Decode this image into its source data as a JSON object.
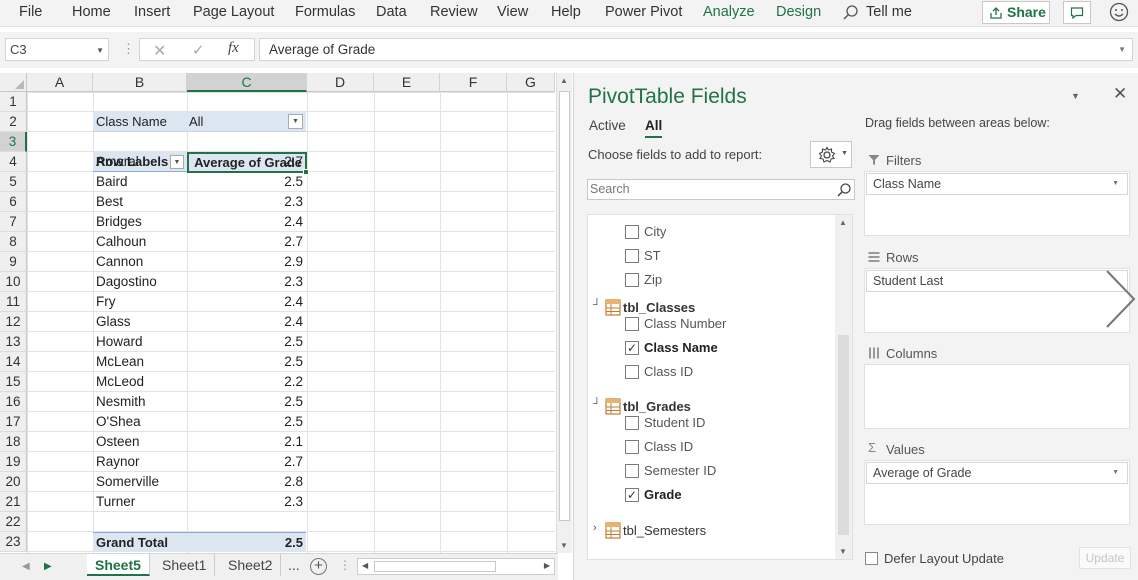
{
  "ribbon": {
    "tabs": [
      "File",
      "Home",
      "Insert",
      "Page Layout",
      "Formulas",
      "Data",
      "Review",
      "View",
      "Help",
      "Power Pivot",
      "Analyze",
      "Design"
    ],
    "tell_me": "Tell me",
    "share": "Share",
    "accent": "#217346"
  },
  "formula_bar": {
    "name_box": "C3",
    "fx": "fx",
    "formula": "Average of Grade"
  },
  "grid": {
    "columns": [
      "A",
      "B",
      "C",
      "D",
      "E",
      "F",
      "G"
    ],
    "selected_column": "C",
    "selected_row": 3,
    "filter": {
      "label": "Class Name",
      "value": "All"
    },
    "header": {
      "row_labels": "Row Labels",
      "value_header": "Average of Grade"
    },
    "rows": [
      {
        "name": "Amaral",
        "value": "2.7"
      },
      {
        "name": "Baird",
        "value": "2.5"
      },
      {
        "name": "Best",
        "value": "2.3"
      },
      {
        "name": "Bridges",
        "value": "2.4"
      },
      {
        "name": "Calhoun",
        "value": "2.7"
      },
      {
        "name": "Cannon",
        "value": "2.9"
      },
      {
        "name": "Dagostino",
        "value": "2.3"
      },
      {
        "name": "Fry",
        "value": "2.4"
      },
      {
        "name": "Glass",
        "value": "2.4"
      },
      {
        "name": "Howard",
        "value": "2.5"
      },
      {
        "name": "McLean",
        "value": "2.5"
      },
      {
        "name": "McLeod",
        "value": "2.2"
      },
      {
        "name": "Nesmith",
        "value": "2.5"
      },
      {
        "name": "O'Shea",
        "value": "2.5"
      },
      {
        "name": "Osteen",
        "value": "2.1"
      },
      {
        "name": "Raynor",
        "value": "2.7"
      },
      {
        "name": "Somerville",
        "value": "2.8"
      },
      {
        "name": "Turner",
        "value": "2.3"
      }
    ],
    "grand_total": {
      "label": "Grand Total",
      "value": "2.5"
    },
    "row_numbers": [
      "1",
      "2",
      "3",
      "4",
      "5",
      "6",
      "7",
      "8",
      "9",
      "10",
      "11",
      "12",
      "13",
      "14",
      "15",
      "16",
      "17",
      "18",
      "19",
      "20",
      "21",
      "22",
      "23"
    ]
  },
  "sheets": {
    "tabs": [
      "Sheet5",
      "Sheet1",
      "Sheet2"
    ],
    "active": "Sheet5",
    "more": "..."
  },
  "pivot": {
    "title": "PivotTable Fields",
    "tabs": [
      "Active",
      "All"
    ],
    "active_tab": "All",
    "choose_label": "Choose fields to add to report:",
    "search_placeholder": "Search",
    "fields_top": [
      {
        "name": "City",
        "checked": false
      },
      {
        "name": "ST",
        "checked": false
      },
      {
        "name": "Zip",
        "checked": false
      }
    ],
    "tables": [
      {
        "name": "tbl_Classes",
        "expanded": true,
        "fields": [
          {
            "name": "Class Number",
            "checked": false
          },
          {
            "name": "Class Name",
            "checked": true
          },
          {
            "name": "Class ID",
            "checked": false
          }
        ]
      },
      {
        "name": "tbl_Grades",
        "expanded": true,
        "fields": [
          {
            "name": "Student ID",
            "checked": false
          },
          {
            "name": "Class ID",
            "checked": false
          },
          {
            "name": "Semester ID",
            "checked": false
          },
          {
            "name": "Grade",
            "checked": true
          }
        ]
      },
      {
        "name": "tbl_Semesters",
        "expanded": false,
        "fields": []
      }
    ],
    "drag_label": "Drag fields between areas below:",
    "areas": {
      "filters": {
        "label": "Filters",
        "item": "Class Name"
      },
      "rows": {
        "label": "Rows",
        "item": "Student Last"
      },
      "columns": {
        "label": "Columns",
        "item": ""
      },
      "values": {
        "label": "Values",
        "item": "Average of Grade"
      }
    },
    "defer_label": "Defer Layout Update",
    "update_label": "Update"
  }
}
